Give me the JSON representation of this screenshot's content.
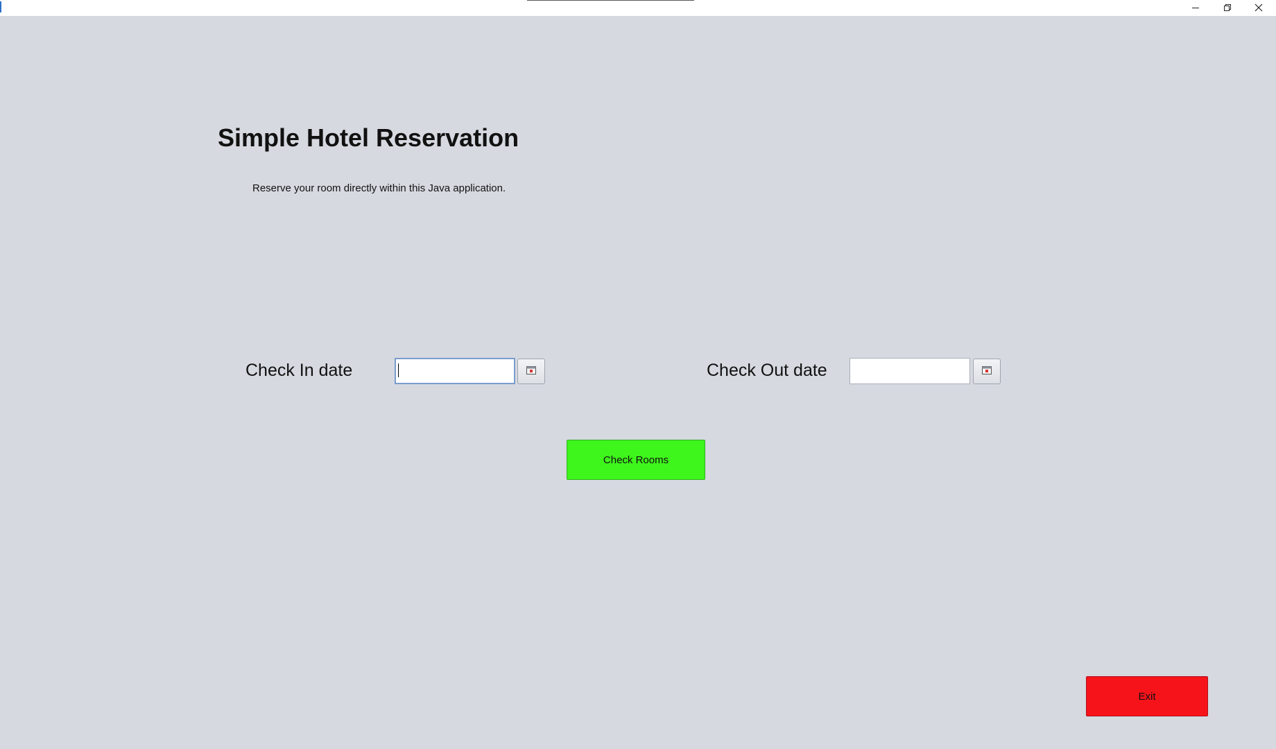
{
  "window": {
    "title": "",
    "controls": {
      "minimize_icon": "minimize-icon",
      "maximize_icon": "restore-icon",
      "close_icon": "close-icon"
    }
  },
  "main": {
    "title": "Simple Hotel Reservation",
    "subtitle": "Reserve your room directly within this Java application.",
    "check_in": {
      "label": "Check In date",
      "value": "",
      "picker_icon": "calendar-icon"
    },
    "check_out": {
      "label": "Check Out date",
      "value": "",
      "picker_icon": "calendar-icon"
    },
    "check_rooms_label": "Check Rooms",
    "exit_label": "Exit"
  },
  "colors": {
    "background": "#d6d9e0",
    "check_rooms_button": "#3ef51c",
    "exit_button": "#f7131a"
  }
}
